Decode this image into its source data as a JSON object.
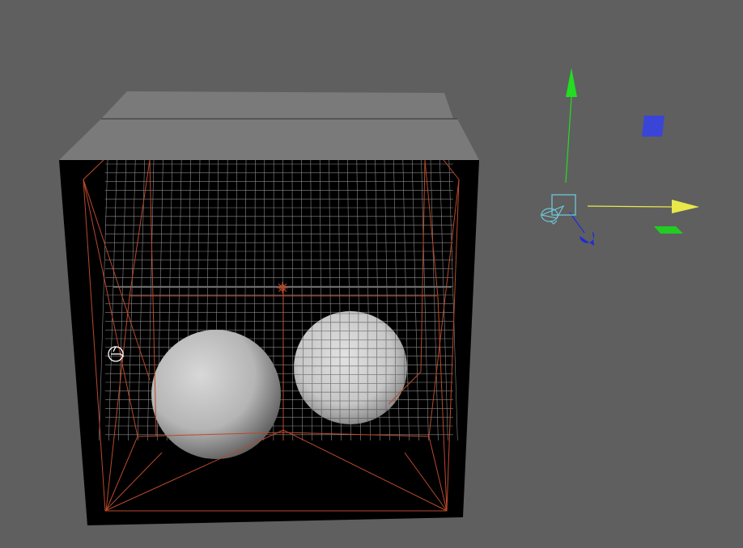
{
  "viewport": {
    "background_color": "#5f5f5f",
    "view_type": "perspective"
  },
  "scene": {
    "objects": [
      {
        "kind": "box",
        "name": "room-box",
        "top_color": "#7a7a7a",
        "inner_color": "#000000"
      },
      {
        "kind": "sphere",
        "name": "sphere-left",
        "color": "#c8c8c8"
      },
      {
        "kind": "sphere",
        "name": "sphere-right",
        "color": "#d2d2d2"
      },
      {
        "kind": "lattice",
        "name": "deformer-lattice",
        "color": "#b94a2c"
      },
      {
        "kind": "grid",
        "name": "wireframe-grid",
        "color": "#8a8a8a"
      }
    ]
  },
  "manipulator": {
    "axis_colors": {
      "x": "#e8e84a",
      "y": "#22dd22",
      "z": "#1e2bd8"
    },
    "plane_handle_colors": {
      "xy": "#3a45d8",
      "xz": "#22cc22"
    },
    "center_color": "#6ec7d8"
  },
  "icons": {
    "camera": "camera-icon",
    "locator": "locator-icon",
    "light": "light-icon"
  }
}
